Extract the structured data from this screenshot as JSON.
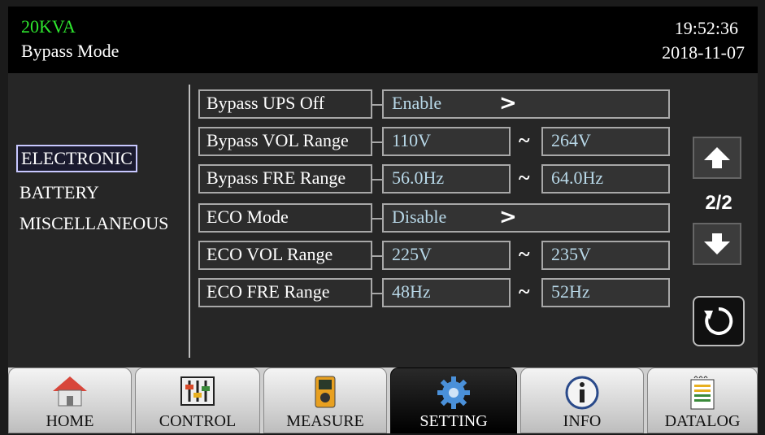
{
  "header": {
    "model": "20KVA",
    "mode": "Bypass Mode",
    "time": "19:52:36",
    "date": "2018-11-07"
  },
  "sidebar": {
    "items": [
      {
        "label": "ELECTRONIC",
        "active": true
      },
      {
        "label": "BATTERY",
        "active": false
      },
      {
        "label": "MISCELLANEOUS",
        "active": false
      }
    ]
  },
  "settings": {
    "rows": [
      {
        "label": "Bypass UPS Off",
        "value": "Enable"
      },
      {
        "label": "Bypass VOL Range",
        "min": "110V",
        "max": "264V"
      },
      {
        "label": "Bypass FRE Range",
        "min": "56.0Hz",
        "max": "64.0Hz"
      },
      {
        "label": "ECO Mode",
        "value": "Disable"
      },
      {
        "label": "ECO VOL Range",
        "min": "225V",
        "max": "235V"
      },
      {
        "label": "ECO FRE Range",
        "min": "48Hz",
        "max": "52Hz"
      }
    ],
    "range_separator": "~",
    "select_arrow": ">"
  },
  "pager": {
    "page": "2/2"
  },
  "tabs": [
    {
      "label": "HOME",
      "icon": "home-icon"
    },
    {
      "label": "CONTROL",
      "icon": "control-icon"
    },
    {
      "label": "MEASURE",
      "icon": "measure-icon"
    },
    {
      "label": "SETTING",
      "icon": "gear-icon",
      "active": true
    },
    {
      "label": "INFO",
      "icon": "info-icon"
    },
    {
      "label": "DATALOG",
      "icon": "datalog-icon"
    }
  ],
  "colors": {
    "model_text": "#2ee62e",
    "value_text": "#b8d8e8",
    "active_tab": "#000000",
    "gear": "#4a90d9"
  }
}
